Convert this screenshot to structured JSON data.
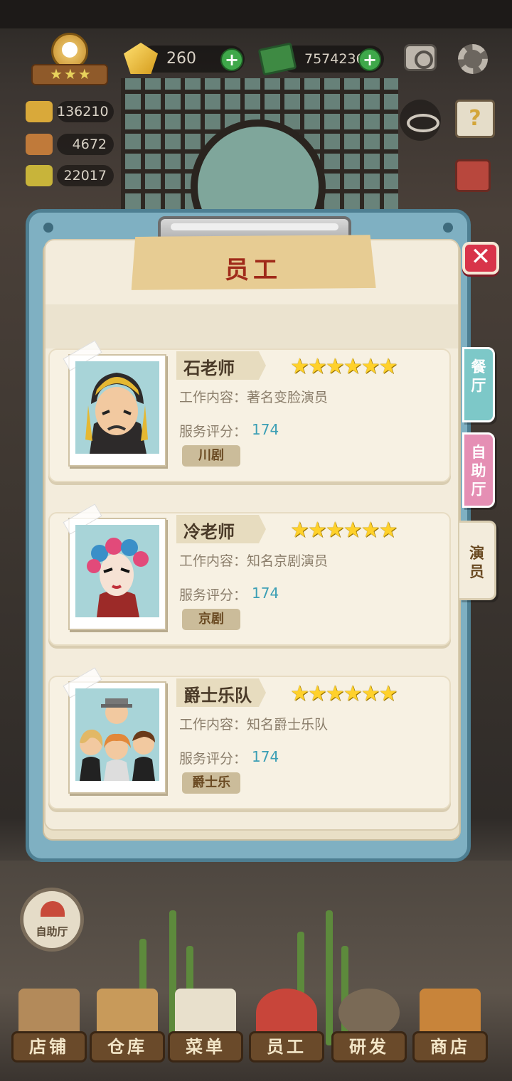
{
  "hud": {
    "gems": "260",
    "cash": "7574236",
    "stats": [
      "136210",
      "4672",
      "22017"
    ],
    "chef_stars": "★★★"
  },
  "dialog": {
    "title": "员工",
    "close": "✕",
    "tabs": [
      {
        "label": "餐\n厅",
        "color": "#7dc8c8"
      },
      {
        "label": "自\n助\n厅",
        "color": "#e58fb4"
      },
      {
        "label": "演\n员",
        "color": "#f3ecdc",
        "active": true
      }
    ],
    "job_prefix": "工作内容：",
    "score_prefix": "服务评分：",
    "employees": [
      {
        "name": "石老师",
        "stars": "★★★★★★",
        "job": "著名变脸演员",
        "score": "174",
        "tag": "川剧"
      },
      {
        "name": "冷老师",
        "stars": "★★★★★★",
        "job": "知名京剧演员",
        "score": "174",
        "tag": "京剧"
      },
      {
        "name": "爵士乐队",
        "stars": "★★★★★★",
        "job": "知名爵士乐队",
        "score": "174",
        "tag": "爵士乐"
      }
    ]
  },
  "buffet_button": "自助厅",
  "nav": [
    "店铺",
    "仓库",
    "菜单",
    "员工",
    "研发",
    "商店"
  ],
  "colors": {
    "board": "#7fb0c2",
    "close": "#d8344a",
    "score": "#3c9fb5",
    "stars": "#ffd12b"
  }
}
